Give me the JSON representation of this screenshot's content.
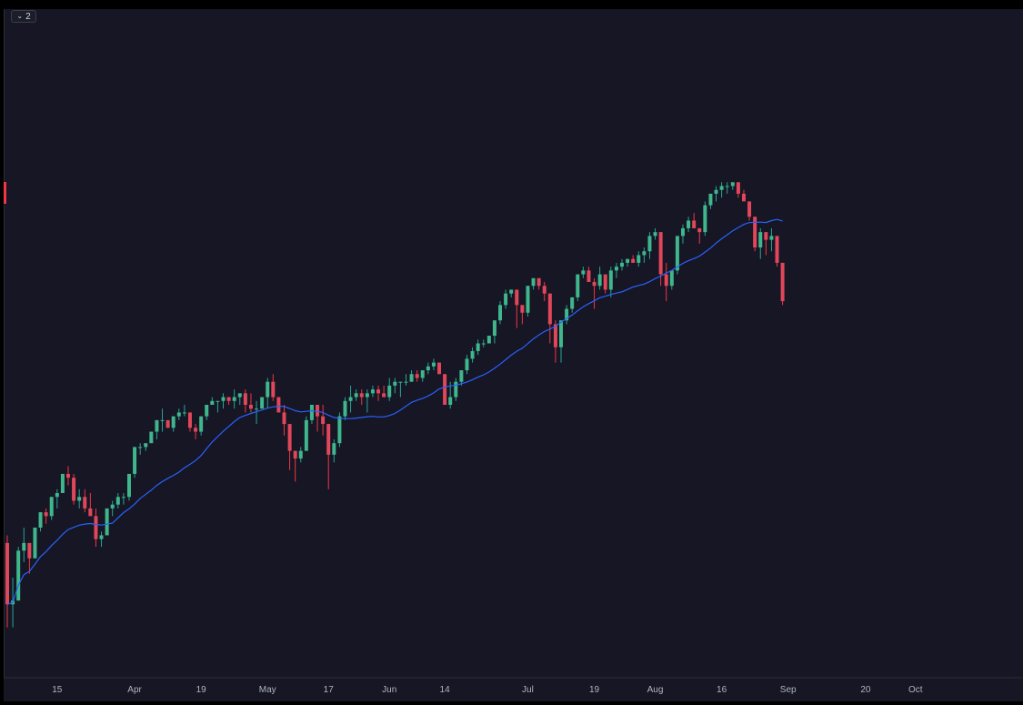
{
  "toolbar": {
    "collapse_label": "2"
  },
  "colors": {
    "background": "#161624",
    "up": "#26a69a",
    "up_fill": "#3fb68b",
    "down": "#f23645",
    "down_fill": "#e0475a",
    "ma_line": "#2962ff",
    "axis_text": "#b2b5be",
    "axis_line": "#2a2e39"
  },
  "chart_data": {
    "type": "candlestick",
    "x_tick_labels": [
      {
        "label": "15",
        "index": 9
      },
      {
        "label": "Apr",
        "index": 23
      },
      {
        "label": "19",
        "index": 35
      },
      {
        "label": "May",
        "index": 47
      },
      {
        "label": "17",
        "index": 58
      },
      {
        "label": "Jun",
        "index": 69
      },
      {
        "label": "14",
        "index": 79
      },
      {
        "label": "Jul",
        "index": 94
      },
      {
        "label": "19",
        "index": 106
      },
      {
        "label": "Aug",
        "index": 117
      },
      {
        "label": "16",
        "index": 129
      },
      {
        "label": "Sep",
        "index": 141
      },
      {
        "label": "20",
        "index": 155
      },
      {
        "label": "Oct",
        "index": 164
      }
    ],
    "y_range": [
      100,
      260
    ],
    "candles": [
      [
        128,
        130,
        106,
        112
      ],
      [
        112,
        119,
        106,
        113
      ],
      [
        113,
        127,
        114,
        126
      ],
      [
        126,
        132,
        123,
        128
      ],
      [
        128,
        128,
        120,
        124
      ],
      [
        124,
        132,
        124,
        132
      ],
      [
        132,
        136,
        131,
        136
      ],
      [
        136,
        137,
        133,
        135
      ],
      [
        135,
        140,
        134,
        140
      ],
      [
        140,
        142,
        137,
        141
      ],
      [
        141,
        146,
        141,
        146
      ],
      [
        146,
        148,
        143,
        145
      ],
      [
        145,
        146,
        138,
        139
      ],
      [
        139,
        142,
        137,
        140
      ],
      [
        140,
        142,
        136,
        137
      ],
      [
        137,
        141,
        135,
        135
      ],
      [
        135,
        137,
        127,
        129
      ],
      [
        129,
        131,
        127,
        130
      ],
      [
        130,
        137,
        130,
        137
      ],
      [
        137,
        139,
        135,
        138
      ],
      [
        138,
        141,
        137,
        140
      ],
      [
        140,
        141,
        138,
        140
      ],
      [
        140,
        146,
        139,
        146
      ],
      [
        146,
        153,
        145,
        153
      ],
      [
        153,
        154,
        151,
        153
      ],
      [
        153,
        154,
        152,
        154
      ],
      [
        154,
        157,
        154,
        157
      ],
      [
        157,
        159,
        155,
        160
      ],
      [
        160,
        163,
        157,
        160
      ],
      [
        160,
        160,
        158,
        158
      ],
      [
        158,
        161,
        157,
        161
      ],
      [
        161,
        163,
        160,
        162
      ],
      [
        162,
        164,
        161,
        162
      ],
      [
        162,
        162,
        157,
        158
      ],
      [
        158,
        159,
        155,
        157
      ],
      [
        157,
        160,
        156,
        161
      ],
      [
        161,
        163,
        160,
        164
      ],
      [
        164,
        166,
        164,
        165
      ],
      [
        165,
        165,
        162,
        165
      ],
      [
        165,
        167,
        163,
        166
      ],
      [
        166,
        166,
        164,
        165
      ],
      [
        165,
        168,
        163,
        166
      ],
      [
        166,
        167,
        164,
        167
      ],
      [
        167,
        168,
        162,
        164
      ],
      [
        164,
        167,
        162,
        163
      ],
      [
        163,
        165,
        159,
        163
      ],
      [
        163,
        166,
        163,
        166
      ],
      [
        166,
        171,
        163,
        170
      ],
      [
        170,
        172,
        165,
        166
      ],
      [
        166,
        164,
        162,
        162
      ],
      [
        162,
        164,
        156,
        159
      ],
      [
        159,
        157,
        147,
        152
      ],
      [
        152,
        151,
        144,
        150
      ],
      [
        150,
        153,
        149,
        152
      ],
      [
        152,
        161,
        152,
        160
      ],
      [
        160,
        164,
        159,
        164
      ],
      [
        164,
        163,
        157,
        161
      ],
      [
        161,
        164,
        156,
        159
      ],
      [
        159,
        157,
        142,
        151
      ],
      [
        151,
        155,
        149,
        154
      ],
      [
        154,
        162,
        153,
        161
      ],
      [
        161,
        166,
        160,
        165
      ],
      [
        165,
        169,
        162,
        166
      ],
      [
        166,
        168,
        165,
        167
      ],
      [
        167,
        168,
        164,
        166
      ],
      [
        166,
        168,
        162,
        167
      ],
      [
        167,
        169,
        166,
        168
      ],
      [
        168,
        169,
        165,
        167
      ],
      [
        167,
        169,
        166,
        166
      ],
      [
        166,
        171,
        165,
        169
      ],
      [
        169,
        171,
        167,
        170
      ],
      [
        170,
        170,
        166,
        170
      ],
      [
        170,
        172,
        169,
        170
      ],
      [
        170,
        173,
        170,
        172
      ],
      [
        172,
        173,
        170,
        171
      ],
      [
        171,
        173,
        170,
        173
      ],
      [
        173,
        175,
        172,
        174
      ],
      [
        174,
        176,
        173,
        175
      ],
      [
        175,
        174,
        172,
        172
      ],
      [
        172,
        169,
        164,
        164
      ],
      [
        164,
        170,
        163,
        166
      ],
      [
        166,
        171,
        165,
        170
      ],
      [
        170,
        173,
        169,
        173
      ],
      [
        173,
        177,
        172,
        176
      ],
      [
        176,
        179,
        175,
        178
      ],
      [
        178,
        181,
        177,
        180
      ],
      [
        180,
        181,
        179,
        180
      ],
      [
        180,
        182,
        180,
        182
      ],
      [
        182,
        186,
        180,
        186
      ],
      [
        186,
        191,
        185,
        190
      ],
      [
        190,
        194,
        189,
        193
      ],
      [
        193,
        194,
        192,
        194
      ],
      [
        194,
        193,
        184,
        190
      ],
      [
        190,
        190,
        185,
        188
      ],
      [
        188,
        195,
        187,
        195
      ],
      [
        195,
        197,
        194,
        197
      ],
      [
        197,
        197,
        194,
        195
      ],
      [
        195,
        196,
        191,
        193
      ],
      [
        193,
        187,
        180,
        185
      ],
      [
        185,
        186,
        175,
        179
      ],
      [
        179,
        185,
        175,
        186
      ],
      [
        186,
        190,
        185,
        189
      ],
      [
        189,
        192,
        188,
        192
      ],
      [
        192,
        198,
        191,
        198
      ],
      [
        198,
        200,
        197,
        199
      ],
      [
        199,
        200,
        196,
        196
      ],
      [
        196,
        197,
        189,
        195
      ],
      [
        195,
        200,
        194,
        198
      ],
      [
        198,
        198,
        193,
        194
      ],
      [
        194,
        200,
        192,
        199
      ],
      [
        199,
        201,
        197,
        200
      ],
      [
        200,
        202,
        199,
        201
      ],
      [
        201,
        202,
        200,
        202
      ],
      [
        202,
        203,
        201,
        201
      ],
      [
        201,
        204,
        200,
        203
      ],
      [
        203,
        205,
        201,
        204
      ],
      [
        204,
        209,
        202,
        208
      ],
      [
        208,
        210,
        207,
        209
      ],
      [
        209,
        207,
        195,
        198
      ],
      [
        198,
        201,
        191,
        195
      ],
      [
        195,
        199,
        194,
        199
      ],
      [
        199,
        208,
        198,
        208
      ],
      [
        208,
        211,
        206,
        210
      ],
      [
        210,
        213,
        209,
        212
      ],
      [
        212,
        214,
        210,
        210
      ],
      [
        210,
        209,
        206,
        209
      ],
      [
        209,
        217,
        208,
        216
      ],
      [
        216,
        219,
        215,
        219
      ],
      [
        219,
        221,
        217,
        220
      ],
      [
        220,
        222,
        218,
        221
      ],
      [
        221,
        222,
        219,
        221
      ],
      [
        221,
        222,
        220,
        222
      ],
      [
        222,
        222,
        218,
        219
      ],
      [
        219,
        220,
        217,
        217
      ],
      [
        217,
        215,
        212,
        213
      ],
      [
        213,
        210,
        204,
        205
      ],
      [
        205,
        210,
        202,
        209
      ],
      [
        209,
        209,
        203,
        207
      ],
      [
        207,
        210,
        204,
        208
      ],
      [
        208,
        205,
        200,
        201
      ],
      [
        201,
        192,
        190,
        191
      ]
    ],
    "ma_period": 20
  }
}
